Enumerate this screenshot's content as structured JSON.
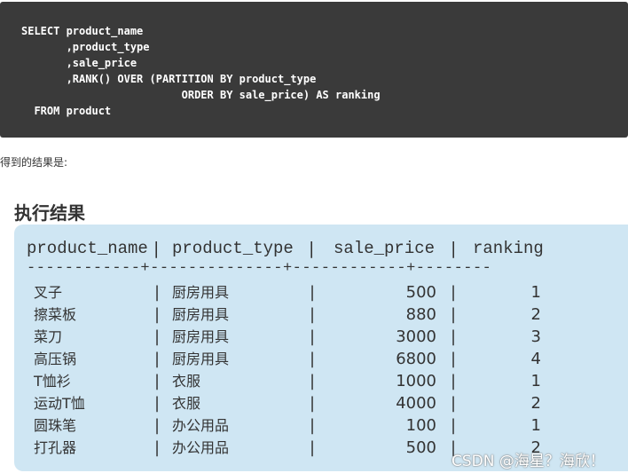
{
  "code": {
    "lines": [
      "SELECT product_name",
      "       ,product_type",
      "       ,sale_price",
      "       ,RANK() OVER (PARTITION BY product_type",
      "                         ORDER BY sale_price) AS ranking",
      "  FROM product"
    ]
  },
  "caption": "得到的结果是:",
  "result": {
    "heading": "执行结果",
    "columns": [
      "product_name",
      "product_type",
      "sale_price",
      "ranking"
    ],
    "separator": "------------+--------------+------------+--------",
    "rows": [
      [
        "叉子",
        "厨房用具",
        "500",
        "1"
      ],
      [
        "擦菜板",
        "厨房用具",
        "880",
        "2"
      ],
      [
        "菜刀",
        "厨房用具",
        "3000",
        "3"
      ],
      [
        "高压锅",
        "厨房用具",
        "6800",
        "4"
      ],
      [
        "T恤衫",
        "衣服",
        "1000",
        "1"
      ],
      [
        "运动T恤",
        "衣服",
        "4000",
        "2"
      ],
      [
        "圆珠笔",
        "办公用品",
        "100",
        "1"
      ],
      [
        "打孔器",
        "办公用品",
        "500",
        "2"
      ]
    ]
  },
  "watermark": "CSDN @海星？海欣！"
}
